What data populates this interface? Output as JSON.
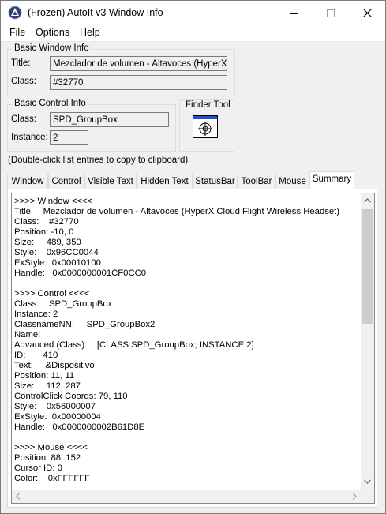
{
  "window": {
    "title": "(Frozen) AutoIt v3 Window Info"
  },
  "titlebar_buttons": [
    "minimize-icon",
    "maximize-icon",
    "close-icon"
  ],
  "menu": {
    "file": "File",
    "options": "Options",
    "help": "Help"
  },
  "basic_window_info": {
    "legend": "Basic Window Info",
    "title_label": "Title:",
    "title_value": "Mezclador de volumen - Altavoces (HyperX Clo",
    "class_label": "Class:",
    "class_value": "#32770"
  },
  "basic_control_info": {
    "legend": "Basic Control Info",
    "class_label": "Class:",
    "class_value": "SPD_GroupBox",
    "instance_label": "Instance:",
    "instance_value": "2"
  },
  "finder_tool": {
    "label": "Finder Tool",
    "icon": "crosshair-target-icon"
  },
  "hint": "(Double-click list entries to copy to clipboard)",
  "tabs": [
    "Window",
    "Control",
    "Visible Text",
    "Hidden Text",
    "StatusBar",
    "ToolBar",
    "Mouse",
    "Summary"
  ],
  "active_tab": "Summary",
  "summary_lines": [
    ">>>> Window <<<<",
    "Title:    Mezclador de volumen - Altavoces (HyperX Cloud Flight Wireless Headset)",
    "Class:    #32770",
    "Position: -10, 0",
    "Size:     489, 350",
    "Style:    0x96CC0044",
    "ExStyle:  0x00010100",
    "Handle:   0x0000000001CF0CC0",
    "",
    ">>>> Control <<<<",
    "Class:    SPD_GroupBox",
    "Instance: 2",
    "ClassnameNN:     SPD_GroupBox2",
    "Name:",
    "Advanced (Class):    [CLASS:SPD_GroupBox; INSTANCE:2]",
    "ID:       410",
    "Text:     &Dispositivo",
    "Position: 11, 11",
    "Size:     112, 287",
    "ControlClick Coords: 79, 110",
    "Style:    0x56000007",
    "ExStyle:  0x00000004",
    "Handle:   0x0000000002B61D8E",
    "",
    ">>>> Mouse <<<<",
    "Position: 88, 152",
    "Cursor ID: 0",
    "Color:    0xFFFFFF"
  ],
  "colors": {
    "accent_blue": "#1f4fd8",
    "border": "#7a7a7a",
    "background": "#f0f0f0"
  }
}
